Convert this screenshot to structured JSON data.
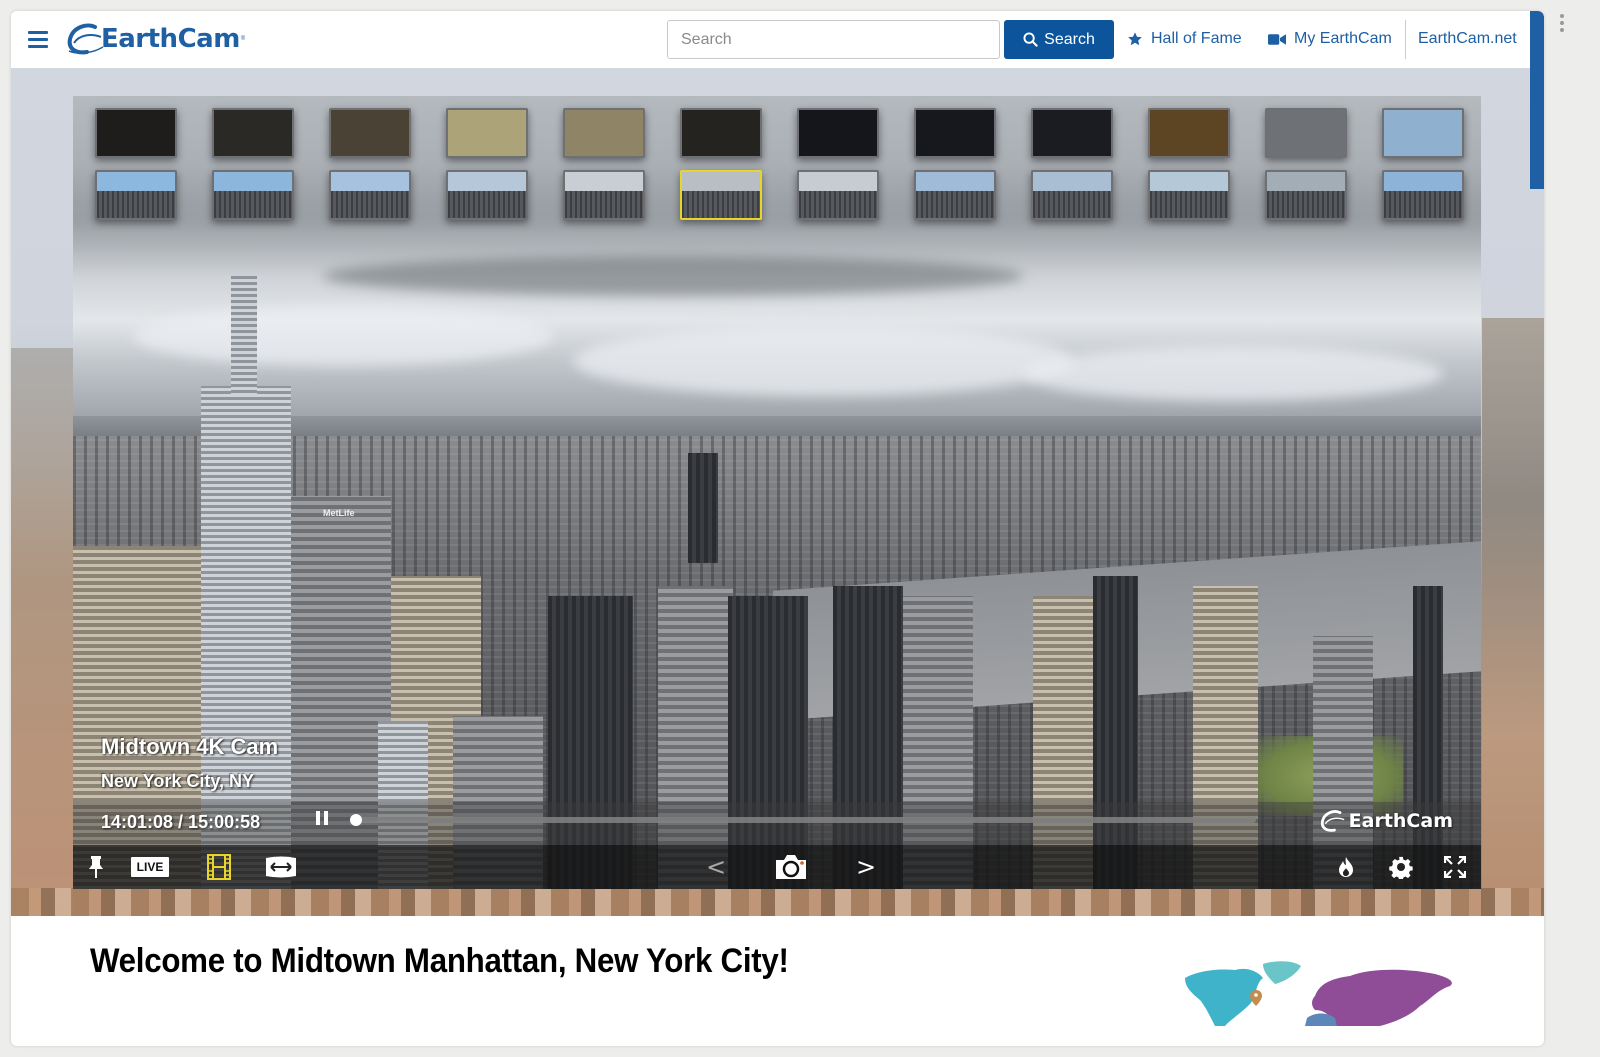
{
  "header": {
    "logo_text": "EarthCam",
    "search": {
      "placeholder": "Search",
      "value": "",
      "button_label": "Search"
    },
    "links": [
      {
        "label": "Hall of Fame",
        "icon": "star-icon"
      },
      {
        "label": "My EarthCam",
        "icon": "video-camera-icon"
      },
      {
        "label": "EarthCam.net",
        "icon": ""
      }
    ],
    "colors": {
      "brand": "#1f5fa3",
      "search_button": "#0c559c"
    }
  },
  "player": {
    "thumbnails": {
      "count_per_row": 12,
      "rows": [
        [
          "#1e1d1b",
          "#2b2925",
          "#4a4234",
          "#aca378",
          "#8f8466",
          "#25231f",
          "#14161c",
          "#16181d",
          "#1a1c22",
          "#5d4524",
          "#6e7277",
          "#8fb1cf"
        ],
        [
          "#8cb8e0",
          "#8db6dd",
          "#a7c2de",
          "#b5c7d9",
          "#c8ced4",
          "#b8bec4",
          "#c6ccd2",
          "#9fbbd8",
          "#a9bed2",
          "#b4c8d8",
          "#a3adb6",
          "#8db3d8"
        ]
      ],
      "selected": {
        "row": 2,
        "index": 6
      }
    },
    "title": "Midtown 4K Cam",
    "location": "New York City, NY",
    "time_current": "14:01:08",
    "time_total": "15:00:58",
    "time_readout": "14:01:08 / 15:00:58",
    "progress_fraction": 0.0,
    "watermark": "EarthCam",
    "landmark_sign": "MetLife",
    "controls": {
      "left": [
        {
          "name": "pin-icon"
        },
        {
          "name": "live-button",
          "label": "LIVE"
        },
        {
          "name": "film-icon",
          "active_color": "#e8d52c"
        },
        {
          "name": "widescreen-icon"
        }
      ],
      "center": [
        {
          "name": "previous-arrow",
          "label": "<"
        },
        {
          "name": "camera-snapshot-icon"
        },
        {
          "name": "next-arrow",
          "label": ">"
        }
      ],
      "right": [
        {
          "name": "flame-icon"
        },
        {
          "name": "gear-icon"
        },
        {
          "name": "fullscreen-icon"
        }
      ]
    }
  },
  "content": {
    "heading": "Welcome to Midtown Manhattan, New York City!",
    "map_colors": {
      "north_america": "#3fb3c9",
      "greenland": "#6ac5c9",
      "eurasia": "#8e4d96",
      "africa": "#5d86b9",
      "pin": "#c48b4e"
    }
  }
}
